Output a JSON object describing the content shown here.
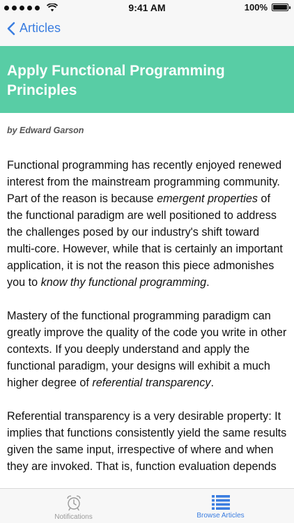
{
  "status": {
    "time": "9:41 AM",
    "battery": "100%"
  },
  "nav": {
    "back_label": "Articles"
  },
  "article": {
    "title": "Apply Functional Programming Principles",
    "author": "by Edward Garson",
    "paragraphs": [
      [
        {
          "t": "Functional programming has recently enjoyed renewed interest from the mainstream programming community. Part of the reason is because "
        },
        {
          "t": "emergent properties",
          "em": true
        },
        {
          "t": " of the functional paradigm are well positioned to address the challenges posed by our industry's shift toward multi-core. However, while that is certainly an important application, it is not the reason this piece admonishes you to "
        },
        {
          "t": "know thy functional programming",
          "em": true
        },
        {
          "t": "."
        }
      ],
      [
        {
          "t": "Mastery of the functional programming paradigm can greatly improve the quality of the code you write in other contexts. If you deeply understand and apply the functional paradigm, your designs will exhibit a much higher degree of "
        },
        {
          "t": "referential transparency",
          "em": true
        },
        {
          "t": "."
        }
      ],
      [
        {
          "t": "Referential transparency is a very desirable property: It implies that functions consistently yield the same results given the same input, irrespective of where and when they are invoked. That is, function evaluation depends"
        }
      ]
    ]
  },
  "tabs": [
    {
      "label": "Notifications",
      "icon": "alarm-clock-icon",
      "active": false
    },
    {
      "label": "Browse Articles",
      "icon": "list-icon",
      "active": true
    }
  ],
  "colors": {
    "accent": "#3a7de0",
    "banner": "#58cda5",
    "inactive_tab": "#9a9a9a"
  }
}
